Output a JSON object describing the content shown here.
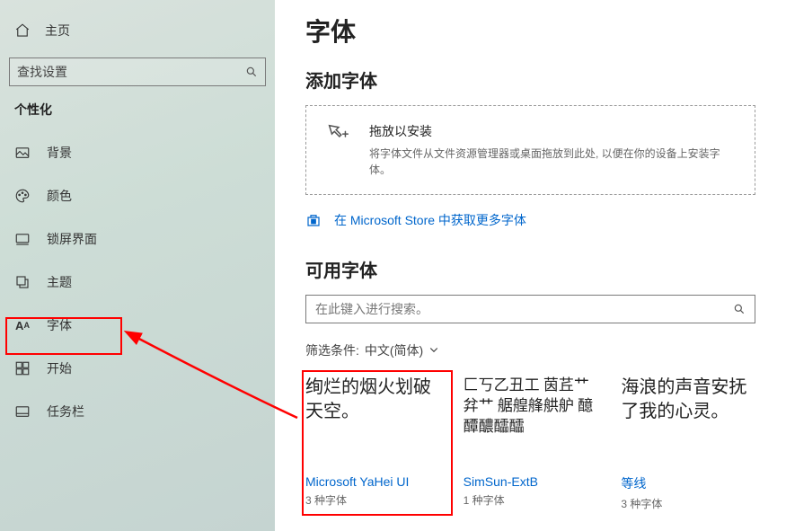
{
  "sidebar": {
    "home_label": "主页",
    "search_placeholder": "查找设置",
    "section_title": "个性化",
    "items": [
      {
        "label": "背景"
      },
      {
        "label": "颜色"
      },
      {
        "label": "锁屏界面"
      },
      {
        "label": "主题"
      },
      {
        "label": "字体"
      },
      {
        "label": "开始"
      },
      {
        "label": "任务栏"
      }
    ]
  },
  "main": {
    "title": "字体",
    "add_heading": "添加字体",
    "drop": {
      "title": "拖放以安装",
      "desc": "将字体文件从文件资源管理器或桌面拖放到此处, 以便在你的设备上安装字体。"
    },
    "store_link": "在 Microsoft Store 中获取更多字体",
    "available_heading": "可用字体",
    "font_search_placeholder": "在此键入进行搜索。",
    "filter_label": "筛选条件:",
    "filter_value": "中文(简体)",
    "fonts": [
      {
        "preview": "绚烂的烟火划破天空。",
        "name": "Microsoft YaHei UI",
        "count": "3 种字体"
      },
      {
        "preview": "匚丂乙丑工 茵茊艹弅艹 艍艎艂舼舮 醷醰醲醽醽",
        "name": "SimSun-ExtB",
        "count": "1 种字体"
      },
      {
        "preview": "海浪的声音安抚了我的心灵。",
        "name": "等线",
        "count": "3 种字体"
      }
    ]
  }
}
